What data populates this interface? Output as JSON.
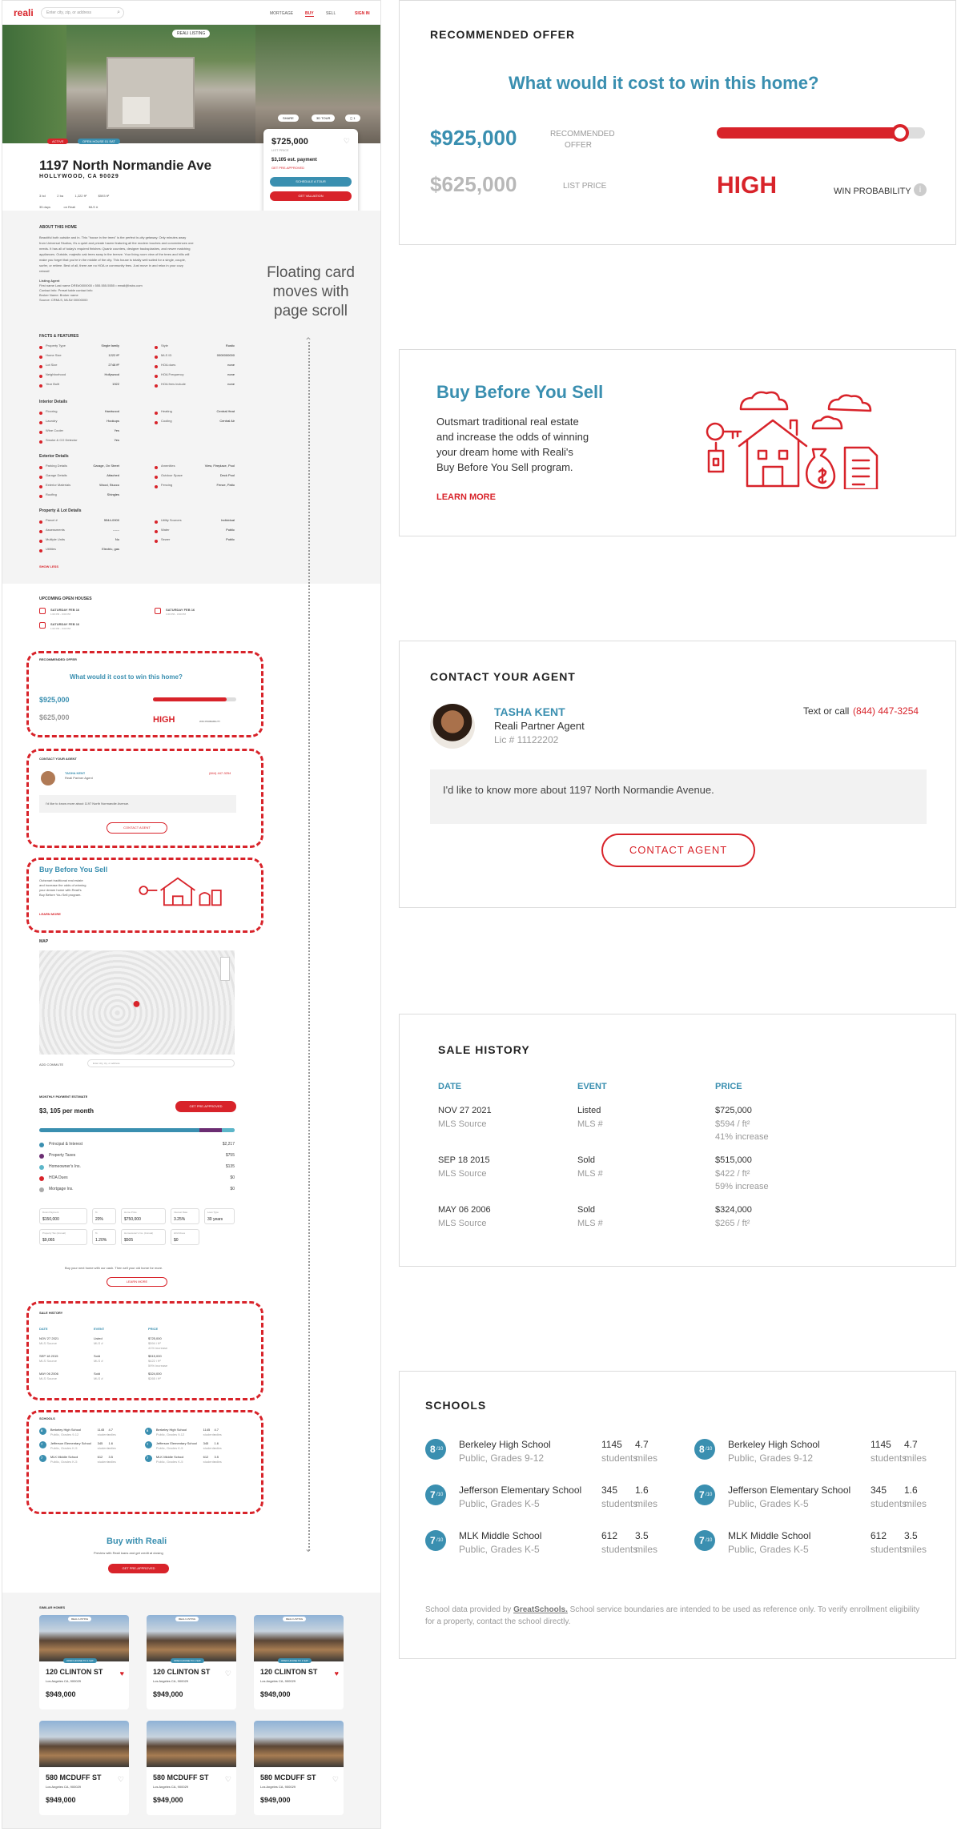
{
  "header": {
    "logo": "reali",
    "search_placeholder": "Enter city, zip, or address",
    "nav": [
      "MORTGAGE",
      "BUY",
      "SELL"
    ],
    "active_nav": "BUY",
    "signin": "SIGN IN"
  },
  "hero": {
    "badge_left": "ACTIVE",
    "badge_open": "OPEN HOUSE 01 SAT",
    "badge_reali": "REALI LISTING",
    "share": "SHARE",
    "tour": "3D TOUR"
  },
  "float_card": {
    "price": "$725,000",
    "sub": "LIST PRICE",
    "payment": "$3,105 est. payment",
    "link": "GET PRE-APPROVED",
    "btn_tour": "SCHEDULE A TOUR",
    "btn_val": "GET VALUATION"
  },
  "listing": {
    "address": "1197 North Normandie Ave",
    "city": "HOLLYWOOD, CA 90029",
    "stats": [
      "3 bd",
      "2 ba",
      "1,222 ft²",
      "$593 ft²"
    ],
    "stats2": [
      "35 days",
      "on Reali",
      "MLS #"
    ]
  },
  "about": {
    "heading": "ABOUT THIS HOME",
    "body": [
      "Beautiful both outside and in. This \"house in the trees\" is the perfect in-city getaway. Only minutes away",
      "from Universal Studios, it's a quiet and private haven featuring all the modern touches and conveniences one",
      "needs. It has all of today's required finishes: Quartz counters, designer backsplashes, and newer matching",
      "appliances. Outside, majestic oak trees sway in the breeze. Your living room view of the trees and hills will",
      "make you forget that you're in the middle of the city. This house is totally well suited for a single, couple,",
      "surfer, or retiree. Best of all, there are no HOA or community fees. Just move in and relax in your cozy",
      "retreat!"
    ],
    "agent": [
      "Listing Agent",
      "First name Last name DRE#0000000 • 555.555.5555 • email@bsbo.com",
      "Contact info: Preset table contact info",
      "Broker Name: Broker name",
      "Source: CRMLS, MLS# 00000000"
    ]
  },
  "facts": {
    "heading": "FACTS & FEATURES",
    "left": [
      [
        "Property Type",
        "Single family"
      ],
      [
        "Home Size",
        "1222 ft²"
      ],
      [
        "Lot Size",
        "2748 ft²"
      ],
      [
        "Neighborhood",
        "Hollywood"
      ],
      [
        "Year Built",
        "1922"
      ]
    ],
    "right": [
      [
        "Style",
        "Rustic"
      ],
      [
        "MLS ID",
        "0000000000"
      ],
      [
        "HOA dues",
        "none"
      ],
      [
        "HOA Frequency",
        "none"
      ],
      [
        "HOA fees include",
        "none"
      ]
    ],
    "interior_heading": "Interior Details",
    "interior_left": [
      [
        "Flooring",
        "Hardwood"
      ],
      [
        "Laundry",
        "Hookups"
      ],
      [
        "Wine Cooler",
        "Yes"
      ],
      [
        "Smoke & CO Detector",
        "Yes"
      ]
    ],
    "interior_right": [
      [
        "Heating",
        "Central Heat"
      ],
      [
        "Cooling",
        "Central Air"
      ]
    ],
    "exterior_heading": "Exterior Details",
    "exterior_left": [
      [
        "Parking Details",
        "Garage, On Street"
      ],
      [
        "Garage Details",
        "Attached"
      ],
      [
        "Exterior Materials",
        "Wood, Stucco"
      ],
      [
        "Roofing",
        "Shingles"
      ]
    ],
    "exterior_right": [
      [
        "Amenities",
        "View, Fireplace, Pool"
      ],
      [
        "Outdoor Space",
        "Deck Pool"
      ],
      [
        "Fencing",
        "Fence, Patio"
      ]
    ],
    "lot_heading": "Property & Lot Details",
    "lot_left": [
      [
        "Parcel #",
        "5544-0000"
      ],
      [
        "Assessments",
        "------"
      ],
      [
        "Multiple Units",
        "No"
      ],
      [
        "Utilities",
        "Electric, gas"
      ]
    ],
    "lot_right": [
      [
        "Utility Sources",
        "Individual"
      ],
      [
        "Water",
        "Public"
      ],
      [
        "Sewer",
        "Public"
      ]
    ],
    "show_less": "SHOW LESS"
  },
  "annotation": {
    "line1": "Floating card",
    "line2": "moves with",
    "line3": "page scroll"
  },
  "openhouse": {
    "heading": "UPCOMING OPEN HOUSES",
    "items": [
      "SATURDAY FEB 16",
      "SATURDAY FEB 16",
      "SATURDAY FEB 16"
    ],
    "time": "1:00 PM - 3:00 PM"
  },
  "offer": {
    "heading": "RECOMMENDED OFFER",
    "question": "What would it cost to win this home?",
    "rec_value": "$925,000",
    "rec_label1": "RECOMMENDED",
    "rec_label2": "OFFER",
    "list_value": "$625,000",
    "list_label": "LIST PRICE",
    "prob": "HIGH",
    "prob_label": "WIN PROBABILITY",
    "slider_level": 0.9
  },
  "agent": {
    "heading": "CONTACT YOUR AGENT",
    "name": "TASHA KENT",
    "role": "Reali Partner Agent",
    "lic": "Lic # 11122202",
    "text_or_call": "Text or call",
    "phone": "(844) 447-3254",
    "message": "I'd like to know more about 1197 North Normandie Avenue.",
    "button": "CONTACT AGENT"
  },
  "bbys": {
    "title": "Buy Before You Sell",
    "body": [
      "Outsmart traditional real estate",
      "and increase the odds of winning",
      "your dream home with Reali's",
      "Buy Before You Sell program."
    ],
    "link": "LEARN MORE"
  },
  "map": {
    "heading": "MAP",
    "commute": "ADD COMMUTE",
    "commute_placeholder": "Enter city, zip, or address"
  },
  "payment": {
    "heading": "MONTHLY PAYMENT ESTIMATE",
    "amount": "$3, 105 per month",
    "button": "GET PRE-APPROVED",
    "items": [
      [
        "Principal & Interest",
        "$2,217",
        "#3a8fb0"
      ],
      [
        "Property Taxes",
        "$755",
        "#6b2d72"
      ],
      [
        "Homeowner's Ins.",
        "$135",
        "#5cb6c9"
      ],
      [
        "HOA Dues",
        "$0",
        "#d8232a"
      ],
      [
        "Mortgage Ins.",
        "$0",
        "#aaaaaa"
      ]
    ],
    "fields": [
      [
        "Down Payment",
        "$150,000"
      ],
      [
        "%",
        "20%"
      ],
      [
        "Home Price",
        "$750,000"
      ],
      [
        "Interest Rate",
        "3.25%"
      ],
      [
        "Loan Type",
        "30 years"
      ],
      [
        "Property Tax (Annual)",
        "$9,065"
      ],
      [
        "%",
        "1.20%"
      ],
      [
        "Homeowner's Ins. (Annual)",
        "$505"
      ],
      [
        "HOA Dues",
        "$0"
      ]
    ],
    "cta": "Buy your next home with our cash. Then sell your old home for more.",
    "learn": "LEARN MORE"
  },
  "sale": {
    "heading": "SALE HISTORY",
    "cols": [
      "DATE",
      "EVENT",
      "PRICE"
    ],
    "rows": [
      {
        "date": "NOV 27 2021",
        "src": "MLS Source",
        "event": "Listed",
        "mls": "MLS #",
        "price": "$725,000",
        "ppsf": "$594 / ft²",
        "note": "41% increase"
      },
      {
        "date": "SEP 18 2015",
        "src": "MLS Source",
        "event": "Sold",
        "mls": "MLS #",
        "price": "$515,000",
        "ppsf": "$422 / ft²",
        "note": "59% increase"
      },
      {
        "date": "MAY 06 2006",
        "src": "MLS Source",
        "event": "Sold",
        "mls": "MLS #",
        "price": "$324,000",
        "ppsf": "$265 / ft²",
        "note": ""
      }
    ]
  },
  "schools": {
    "heading": "SCHOOLS",
    "items": [
      {
        "rating": "8",
        "name": "Berkeley High School",
        "type": "Public, Grades 9-12",
        "students": "1145",
        "miles": "4.7"
      },
      {
        "rating": "7",
        "name": "Jefferson Elementary School",
        "type": "Public, Grades K-5",
        "students": "345",
        "miles": "1.6"
      },
      {
        "rating": "7",
        "name": "MLK Middle School",
        "type": "Public, Grades K-5",
        "students": "612",
        "miles": "3.5"
      }
    ],
    "students_label": "students",
    "miles_label": "miles",
    "of": "/10",
    "note_prefix": "School data provided by",
    "note_link": "GreatSchools.",
    "note_rest": "School service boundaries are intended to be used as reference only. To verify enrollment",
    "note_rest2": "eligibility for a property, contact the school directly."
  },
  "buyreali": {
    "title": "Buy with Reali",
    "sub": "Preview with Reali loans and get credit at closing",
    "button": "GET PRE-APPROVED"
  },
  "similar": {
    "heading": "SIMILAR HOMES",
    "row1": {
      "addr": "120 CLINTON ST",
      "city": "Los Angeles CA, 900029",
      "price": "$949,000",
      "badge": "OPEN HOUSE TO 1 SAT",
      "top": "REALI LISTING"
    },
    "row2": {
      "addr": "580 MCDUFF ST",
      "city": "Los Angeles CA, 900029",
      "price": "$949,000"
    }
  },
  "colors": {
    "accent_red": "#d8232a",
    "accent_blue": "#3a8fb0"
  }
}
